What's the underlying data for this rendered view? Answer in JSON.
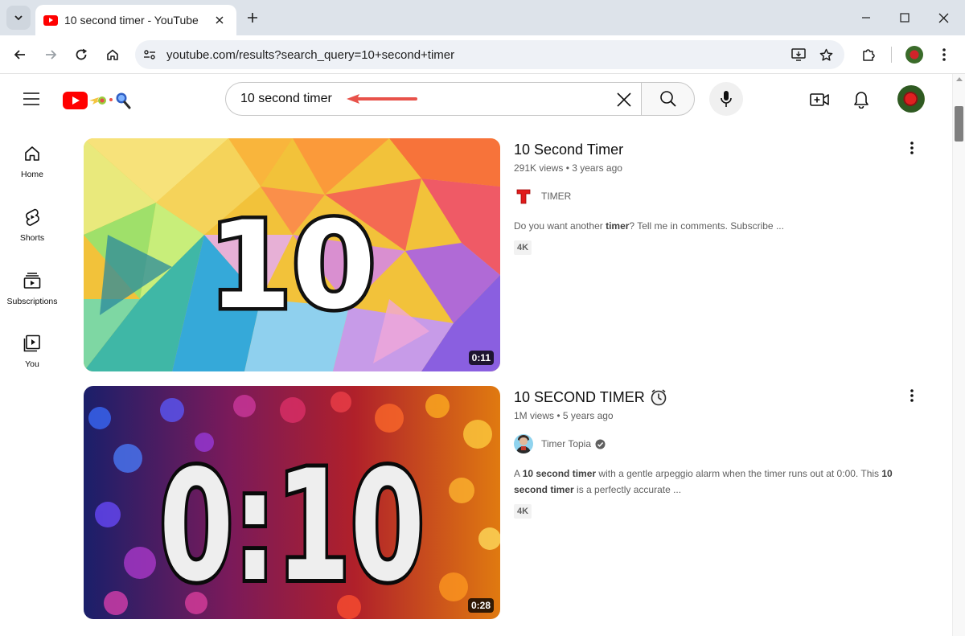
{
  "browser": {
    "tab_title": "10 second timer - YouTube",
    "url": "youtube.com/results?search_query=10+second+timer"
  },
  "search": {
    "value": "10 second timer"
  },
  "guide": [
    {
      "label": "Home"
    },
    {
      "label": "Shorts"
    },
    {
      "label": "Subscriptions"
    },
    {
      "label": "You"
    }
  ],
  "results": [
    {
      "title": "10 Second Timer",
      "views": "291K views",
      "age": "3 years ago",
      "channel": "TIMER",
      "description": [
        "Do you want another ",
        "timer",
        "? Tell me in comments. Subscribe ..."
      ],
      "badge": "4K",
      "duration": "0:11",
      "thumb_text": "10"
    },
    {
      "title": "10 SECOND TIMER",
      "views": "1M views",
      "age": "5 years ago",
      "channel": "Timer Topia",
      "description": [
        "A ",
        "10 second timer",
        " with a gentle arpeggio alarm when the timer runs out at 0:00. This ",
        "10 second timer",
        " is a perfectly accurate ..."
      ],
      "badge": "4K",
      "duration": "0:28",
      "thumb_text": "0:10"
    }
  ],
  "colors": {
    "brand_red": "#ff0000",
    "annotation_arrow": "#e8524a"
  },
  "icons": {
    "tab_list": "chevron-down-icon",
    "close": "close-icon",
    "new_tab": "plus-icon",
    "back": "arrow-left-icon",
    "forward": "arrow-right-icon",
    "reload": "reload-icon",
    "home": "home-icon",
    "install": "install-app-icon",
    "bookmark": "star-icon",
    "extensions": "puzzle-icon",
    "menu": "kebab-icon",
    "search": "search-icon",
    "mic": "mic-icon",
    "create": "create-video-icon",
    "notifications": "bell-icon"
  }
}
